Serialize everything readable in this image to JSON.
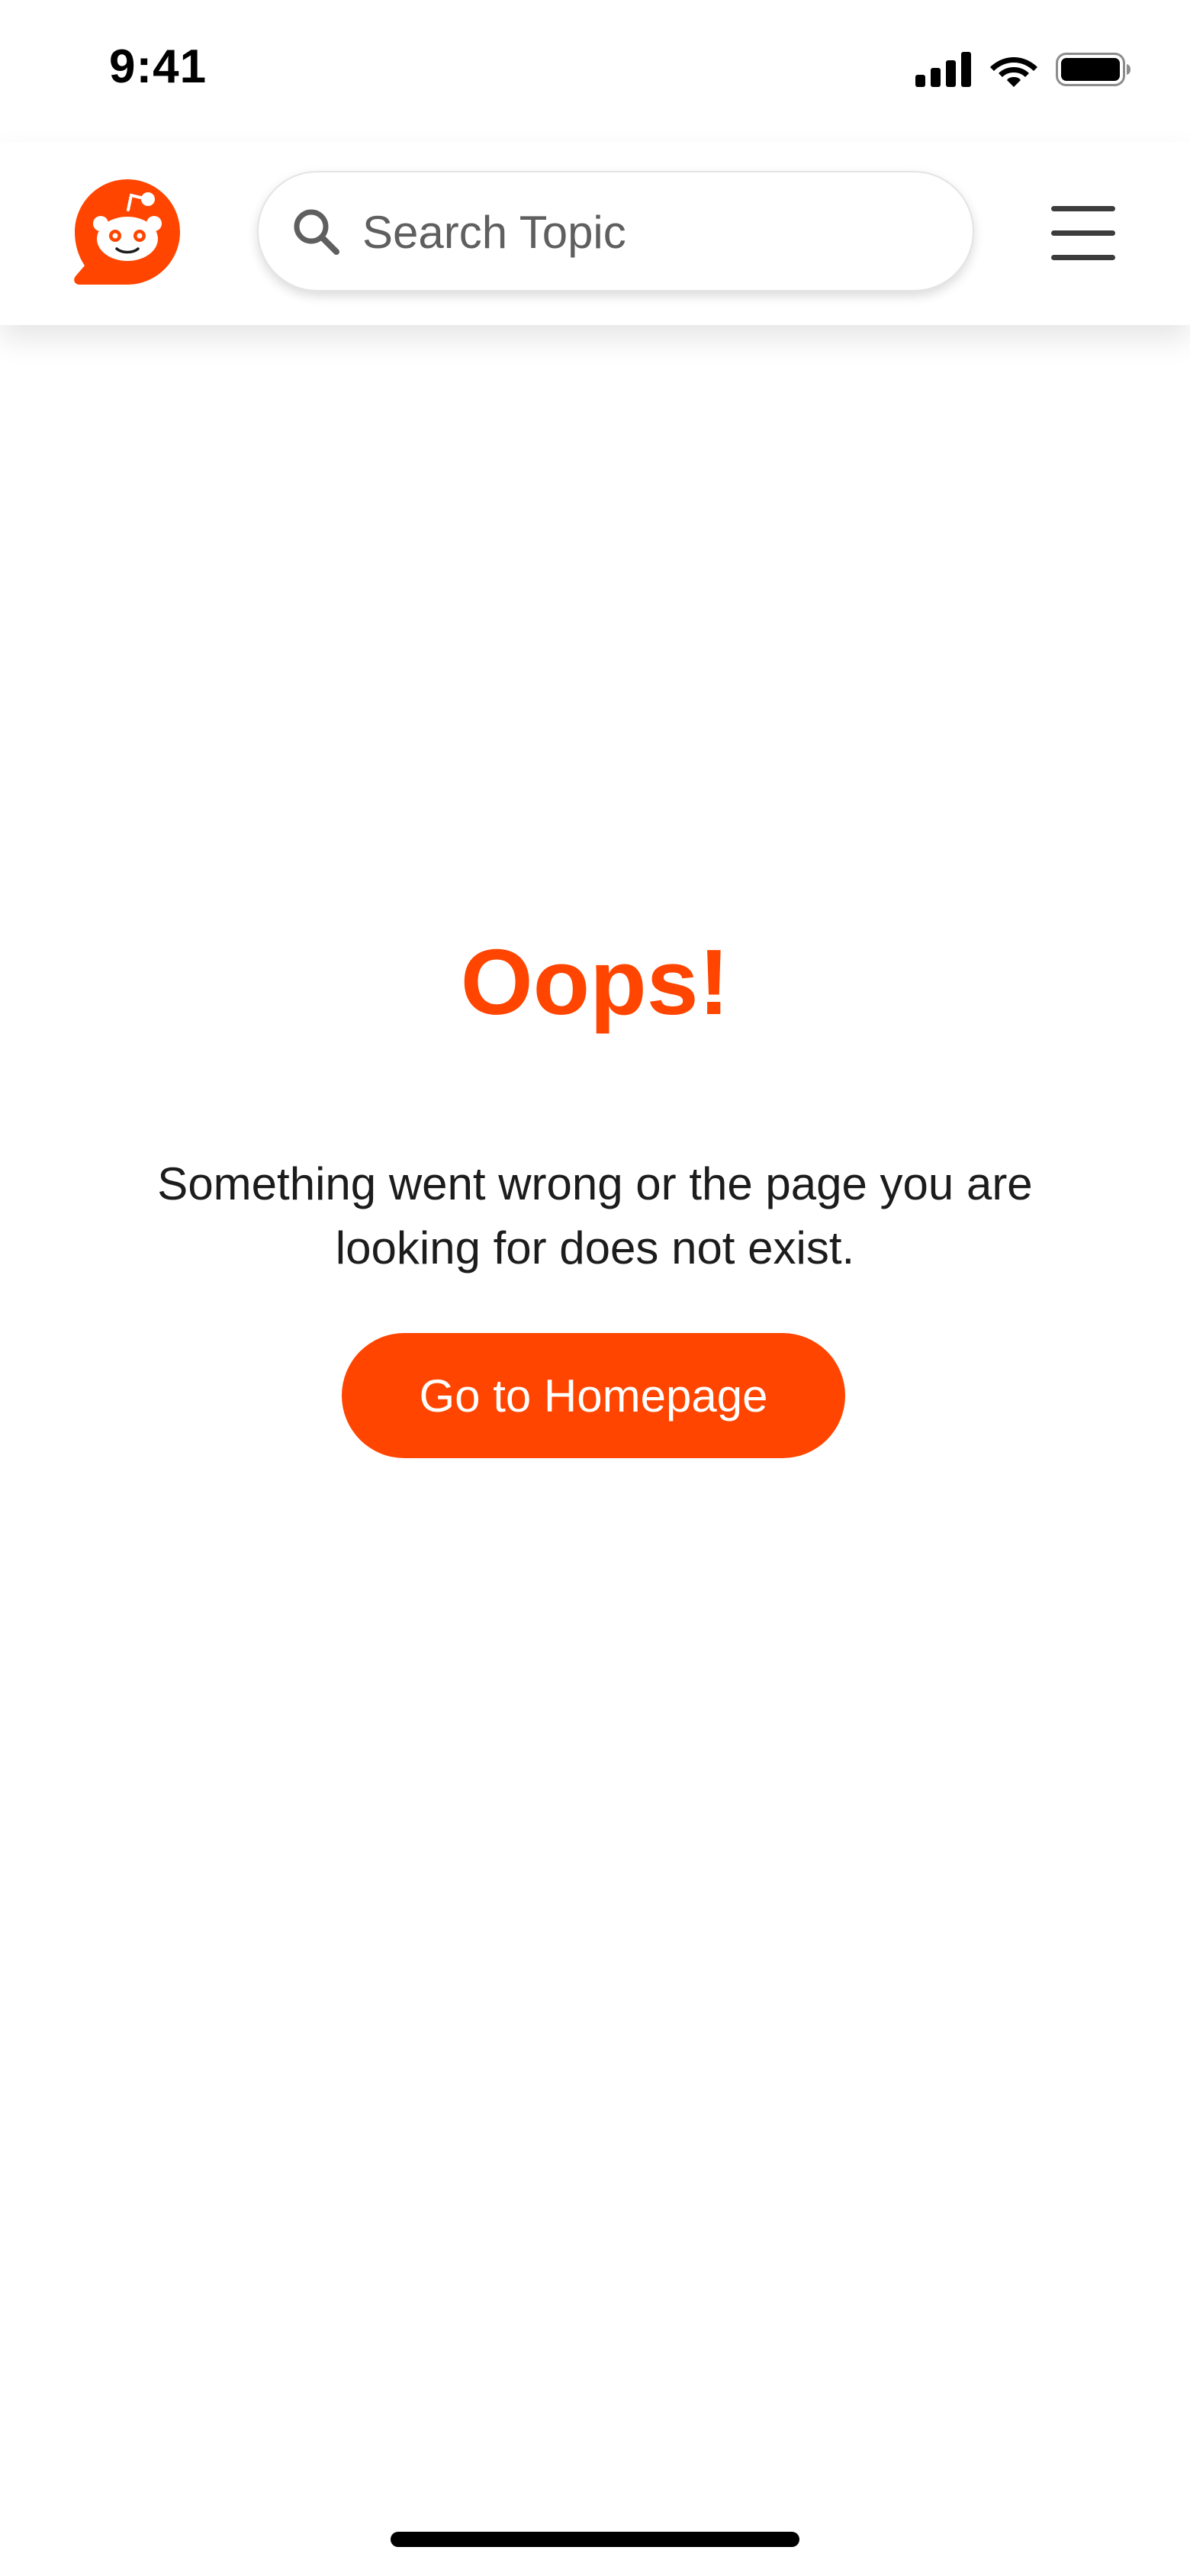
{
  "status_bar": {
    "time": "9:41"
  },
  "header": {
    "logo_icon": "reddit-snoo-logo",
    "search": {
      "placeholder": "Search Topic",
      "value": ""
    },
    "menu_icon": "hamburger-menu-icon"
  },
  "error": {
    "title": "Oops!",
    "message": "Something went wrong or the page you are looking for does not exist.",
    "button_label": "Go to Homepage"
  },
  "colors": {
    "accent": "#ff4500",
    "text": "#1c1c1c",
    "background": "#ffffff"
  }
}
